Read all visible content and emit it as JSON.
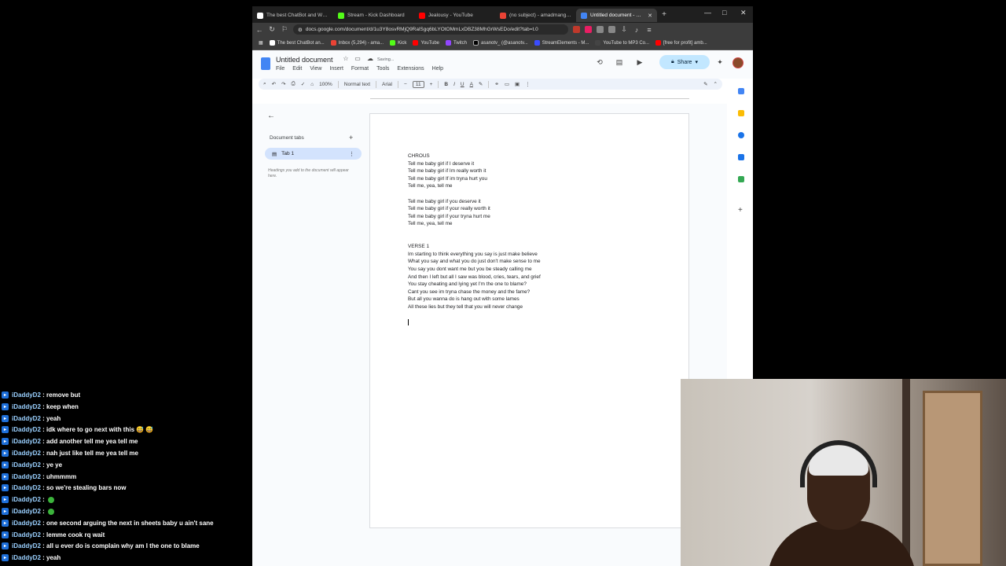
{
  "browser": {
    "tabs": [
      {
        "label": "The best ChatBot and Widget",
        "color": "#ffffff"
      },
      {
        "label": "Stream - Kick Dashboard",
        "color": "#53fc18"
      },
      {
        "label": "Jealousy - YouTube",
        "color": "#ff0000"
      },
      {
        "label": "(no subject) - amadmangame",
        "color": "#ea4335"
      },
      {
        "label": "Untitled document - Goog",
        "color": "#4285f4"
      }
    ],
    "url": "docs.google.com/document/d/1u3Y8osvRMjQ9RalSgq6bLYOtOMmLxDBZ38MhGrWsEDo/edit?tab=t.0",
    "bookmarks": [
      {
        "label": "The best ChatBot an...",
        "color": "#ffffff"
      },
      {
        "label": "Inbox (5,294) - ama...",
        "color": "#ea4335"
      },
      {
        "label": "Kick",
        "color": "#53fc18"
      },
      {
        "label": "YouTube",
        "color": "#ff0000"
      },
      {
        "label": "Twitch",
        "color": "#9146ff"
      },
      {
        "label": "asanotv_ (@asanotv...",
        "color": "#000000"
      },
      {
        "label": "StreamElements - M...",
        "color": "#3a4cff"
      },
      {
        "label": "YouTube to MP3 Co...",
        "color": "#444444"
      },
      {
        "label": "[free for profit] amb...",
        "color": "#ff0000"
      }
    ]
  },
  "docs": {
    "title": "Untitled document",
    "saving": "Saving...",
    "menu": [
      "File",
      "Edit",
      "View",
      "Insert",
      "Format",
      "Tools",
      "Extensions",
      "Help"
    ],
    "share_label": "Share",
    "toolbar": {
      "zoom": "100%",
      "style": "Normal text",
      "font": "Arial",
      "size": "11"
    },
    "sidebar": {
      "heading": "Document tabs",
      "tab_label": "Tab 1",
      "hint": "Headings you add to the document will appear here."
    },
    "body": "CHROUS\nTell me baby girl if I deserve it\nTell me baby girl if Im really worth it\nTell me baby girl If im tryna hurt you\nTell me, yea, tell me\n\nTell me baby girl if you deserve it\nTell me baby girl if your really worth it\nTell me baby girl if your tryna hurt me\nTell me, yea, tell me\n\n\nVERSE 1\nIm starting to think everything you say is just make believe\nWhat you say and what you do just don't make sense to me\nYou say you dont want me but you be steady calling me\nAnd then I left but all I saw was blood, cries, tears, and grief\nYou stay cheating and lying yet I'm the one to blame?\nCant you see im tryna chase the money and the fame?\nBut all you wanna do is hang out with some lames\nAll these lies but they tell that you will never change"
  },
  "chat": [
    {
      "user": "iDaddyD2",
      "msg": "remove but"
    },
    {
      "user": "iDaddyD2",
      "msg": "keep when"
    },
    {
      "user": "iDaddyD2",
      "msg": "yeah"
    },
    {
      "user": "iDaddyD2",
      "msg": "idk where to go next with this 😅 😅"
    },
    {
      "user": "iDaddyD2",
      "msg": "add another tell me yea tell me"
    },
    {
      "user": "iDaddyD2",
      "msg": "nah just like tell me yea tell me"
    },
    {
      "user": "iDaddyD2",
      "msg": "ye ye"
    },
    {
      "user": "iDaddyD2",
      "msg": "uhmmmm"
    },
    {
      "user": "iDaddyD2",
      "msg": "so we're stealing bars now"
    },
    {
      "user": "iDaddyD2",
      "msg": ""
    },
    {
      "user": "iDaddyD2",
      "msg": ""
    },
    {
      "user": "iDaddyD2",
      "msg": "one second arguing the next in sheets baby u ain't sane"
    },
    {
      "user": "iDaddyD2",
      "msg": "lemme cook rq wait"
    },
    {
      "user": "iDaddyD2",
      "msg": "all u ever do is complain why am I the one to blame"
    },
    {
      "user": "iDaddyD2",
      "msg": "yeah"
    }
  ]
}
